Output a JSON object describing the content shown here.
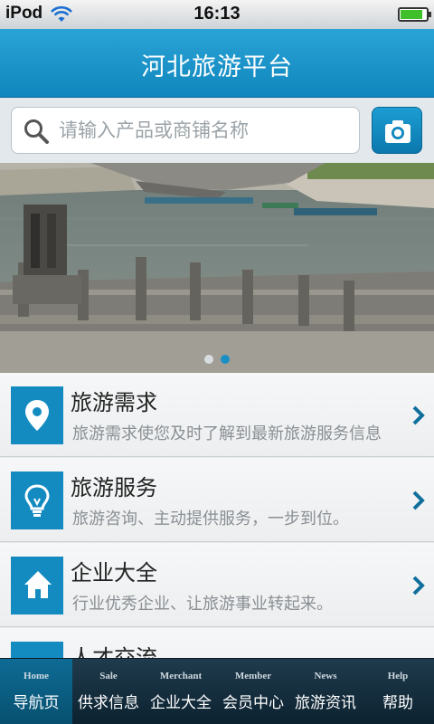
{
  "status_bar": {
    "carrier": "iPod",
    "time": "16:13",
    "battery_level": 0.85
  },
  "header": {
    "title": "河北旅游平台"
  },
  "search": {
    "placeholder": "请输入产品或商铺名称",
    "icon": "search-icon",
    "button_icon": "camera-icon"
  },
  "banner": {
    "slides": 2,
    "active_slide": 2
  },
  "list": {
    "items": [
      {
        "title": "旅游需求",
        "desc": "旅游需求使您及时了解到最新旅游服务信息",
        "icon": "location-pin-icon"
      },
      {
        "title": "旅游服务",
        "desc": "旅游咨询、主动提供服务，一步到位。",
        "icon": "lightbulb-icon"
      },
      {
        "title": "企业大全",
        "desc": "行业优秀企业、让旅游事业转起来。",
        "icon": "home-icon"
      },
      {
        "title": "人才交流",
        "desc": "",
        "icon": "people-icon"
      }
    ]
  },
  "tabbar": {
    "tabs": [
      {
        "en": "Home",
        "cn": "导航页",
        "active": true
      },
      {
        "en": "Sale",
        "cn": "供求信息"
      },
      {
        "en": "Merchant",
        "cn": "企业大全"
      },
      {
        "en": "Member",
        "cn": "会员中心"
      },
      {
        "en": "News",
        "cn": "旅游资讯"
      },
      {
        "en": "Help",
        "cn": "帮助"
      }
    ]
  },
  "colors": {
    "accent": "#138bc1",
    "header": "#1a96cc",
    "tabbar": "#14303f"
  }
}
